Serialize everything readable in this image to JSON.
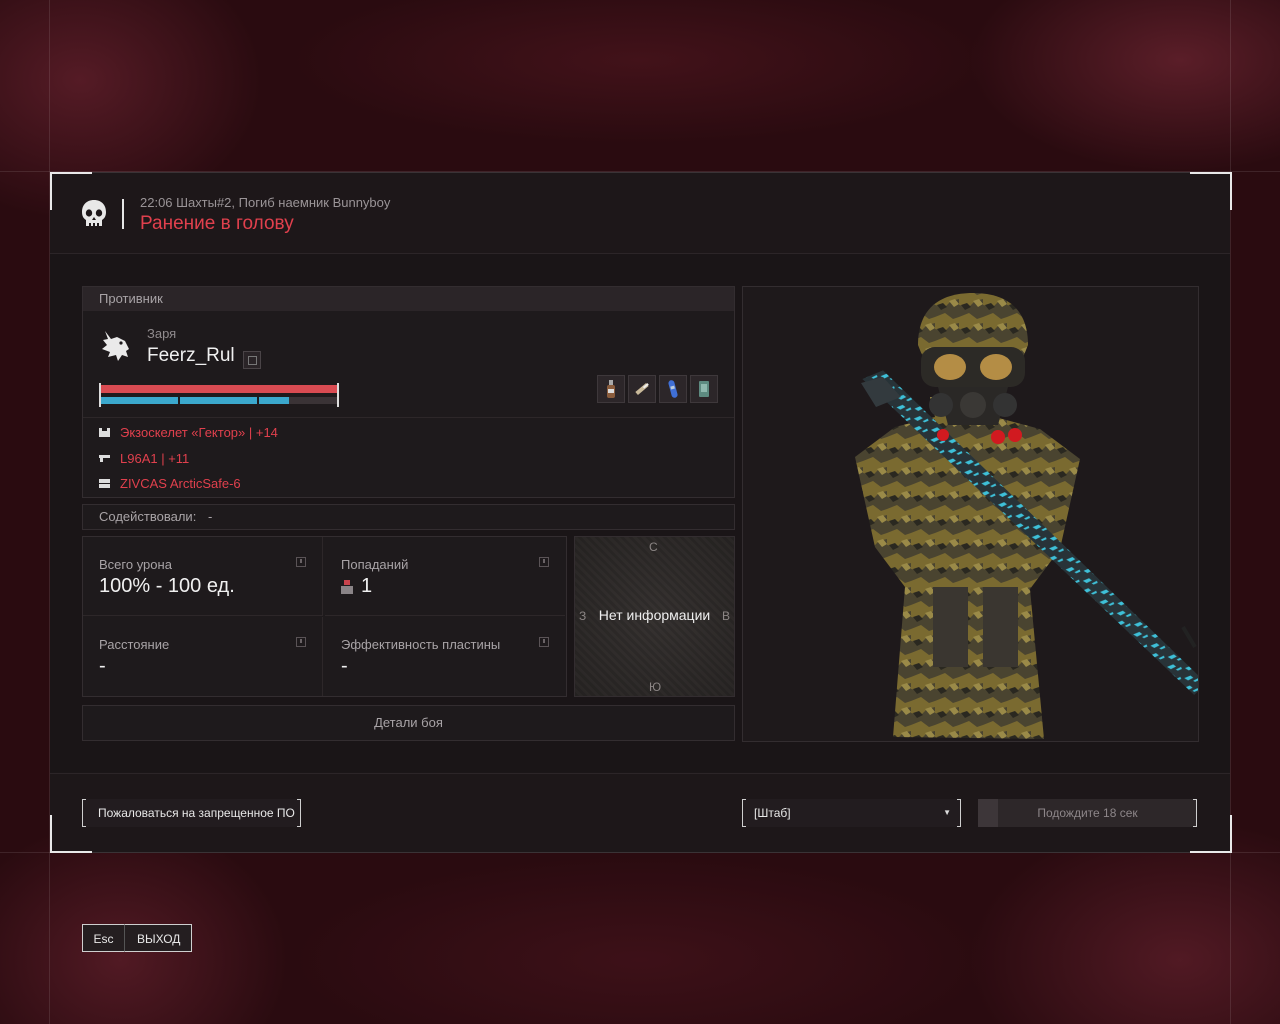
{
  "header": {
    "event": "22:06 Шахты#2, Погиб наемник Bunnyboy",
    "title": "Ранение в голову"
  },
  "enemy": {
    "section_label": "Противник",
    "faction": "Заря",
    "nickname": "Feerz_Rul",
    "armor_fraction": 0.79,
    "consumables": [
      "bottle-icon",
      "syringe-icon",
      "canister-icon",
      "battery-icon"
    ],
    "equipment": [
      {
        "icon": "armor-icon",
        "text": "Экзоскелет «Гектор» | +14"
      },
      {
        "icon": "rifle-icon",
        "text": "L96A1 | +11"
      },
      {
        "icon": "container-icon",
        "text": "ZIVCAS ArcticSafe-6"
      }
    ]
  },
  "assist": {
    "label": "Содействовали:",
    "value": "-"
  },
  "stats": {
    "damage": {
      "label": "Всего урона",
      "value": "100% - 100 ед."
    },
    "hits": {
      "label": "Попаданий",
      "value": "1"
    },
    "distance": {
      "label": "Расстояние",
      "value": "-"
    },
    "plate": {
      "label": "Эффективность пластины",
      "value": "-"
    }
  },
  "compass": {
    "north": "С",
    "south": "Ю",
    "west": "З",
    "east": "В",
    "message": "Нет информации"
  },
  "details_button": "Детали боя",
  "footer": {
    "report_button": "Пожаловаться на запрещенное ПО",
    "respawn_select": "[Штаб]",
    "wait_button": "Подождите 18 сек",
    "wait_progress": 0.09
  },
  "exit": {
    "key": "Esc",
    "label": "ВЫХОД"
  }
}
